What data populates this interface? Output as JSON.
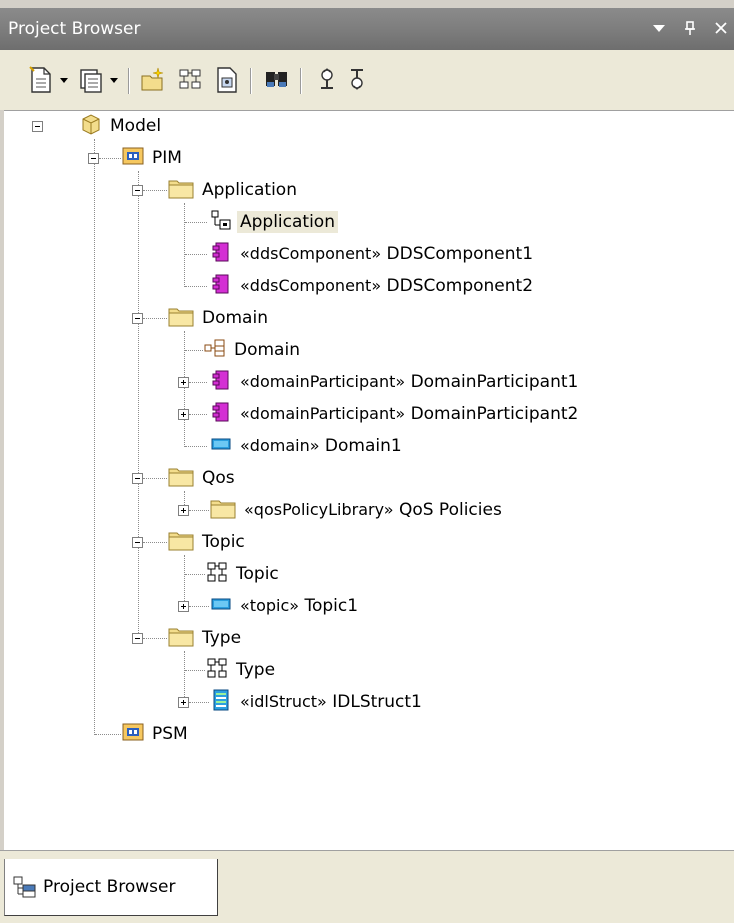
{
  "window": {
    "title": "Project Browser",
    "controls": {
      "dropdown": "▾",
      "pin": "ᵽ",
      "close": "×"
    }
  },
  "toolbar": {
    "buttons": [
      {
        "name": "new-package-button",
        "icon": "new-document-icon"
      },
      {
        "name": "new-diagram-button",
        "icon": "new-diagram-icon"
      },
      {
        "name": "new-element-button",
        "icon": "new-element-icon"
      },
      {
        "name": "add-child-button",
        "icon": "hierarchy-icon"
      },
      {
        "name": "properties-button",
        "icon": "properties-icon"
      },
      {
        "name": "find-button",
        "icon": "binoculars-icon"
      },
      {
        "name": "move-up-button",
        "icon": "move-up-icon"
      },
      {
        "name": "move-down-button",
        "icon": "move-down-icon"
      }
    ]
  },
  "tree": {
    "model": "Model",
    "pim": "PIM",
    "application_pkg": "Application",
    "application_diagram": "Application",
    "dds1_stereo": "«ddsComponent»",
    "dds1_name": "DDSComponent1",
    "dds2_stereo": "«ddsComponent»",
    "dds2_name": "DDSComponent2",
    "domain_pkg": "Domain",
    "domain_diagram": "Domain",
    "dp1_stereo": "«domainParticipant»",
    "dp1_name": "DomainParticipant1",
    "dp2_stereo": "«domainParticipant»",
    "dp2_name": "DomainParticipant2",
    "domain1_stereo": "«domain»",
    "domain1_name": "Domain1",
    "qos_pkg": "Qos",
    "qos_lib_stereo": "«qosPolicyLibrary»",
    "qos_lib_name": "QoS Policies",
    "topic_pkg": "Topic",
    "topic_diagram": "Topic",
    "topic1_stereo": "«topic»",
    "topic1_name": "Topic1",
    "type_pkg": "Type",
    "type_diagram": "Type",
    "idl_stereo": "«idlStruct»",
    "idl_name": "IDLStruct1",
    "psm": "PSM"
  },
  "tabs": {
    "active": "Project Browser"
  },
  "colors": {
    "title_bar": "#7c7c7c",
    "toolbar_bg": "#ece9d8",
    "folder": "#f3dd8c",
    "component": "#d42fd4",
    "block": "#2a9fe0",
    "package_blue": "#2b5fbf"
  }
}
